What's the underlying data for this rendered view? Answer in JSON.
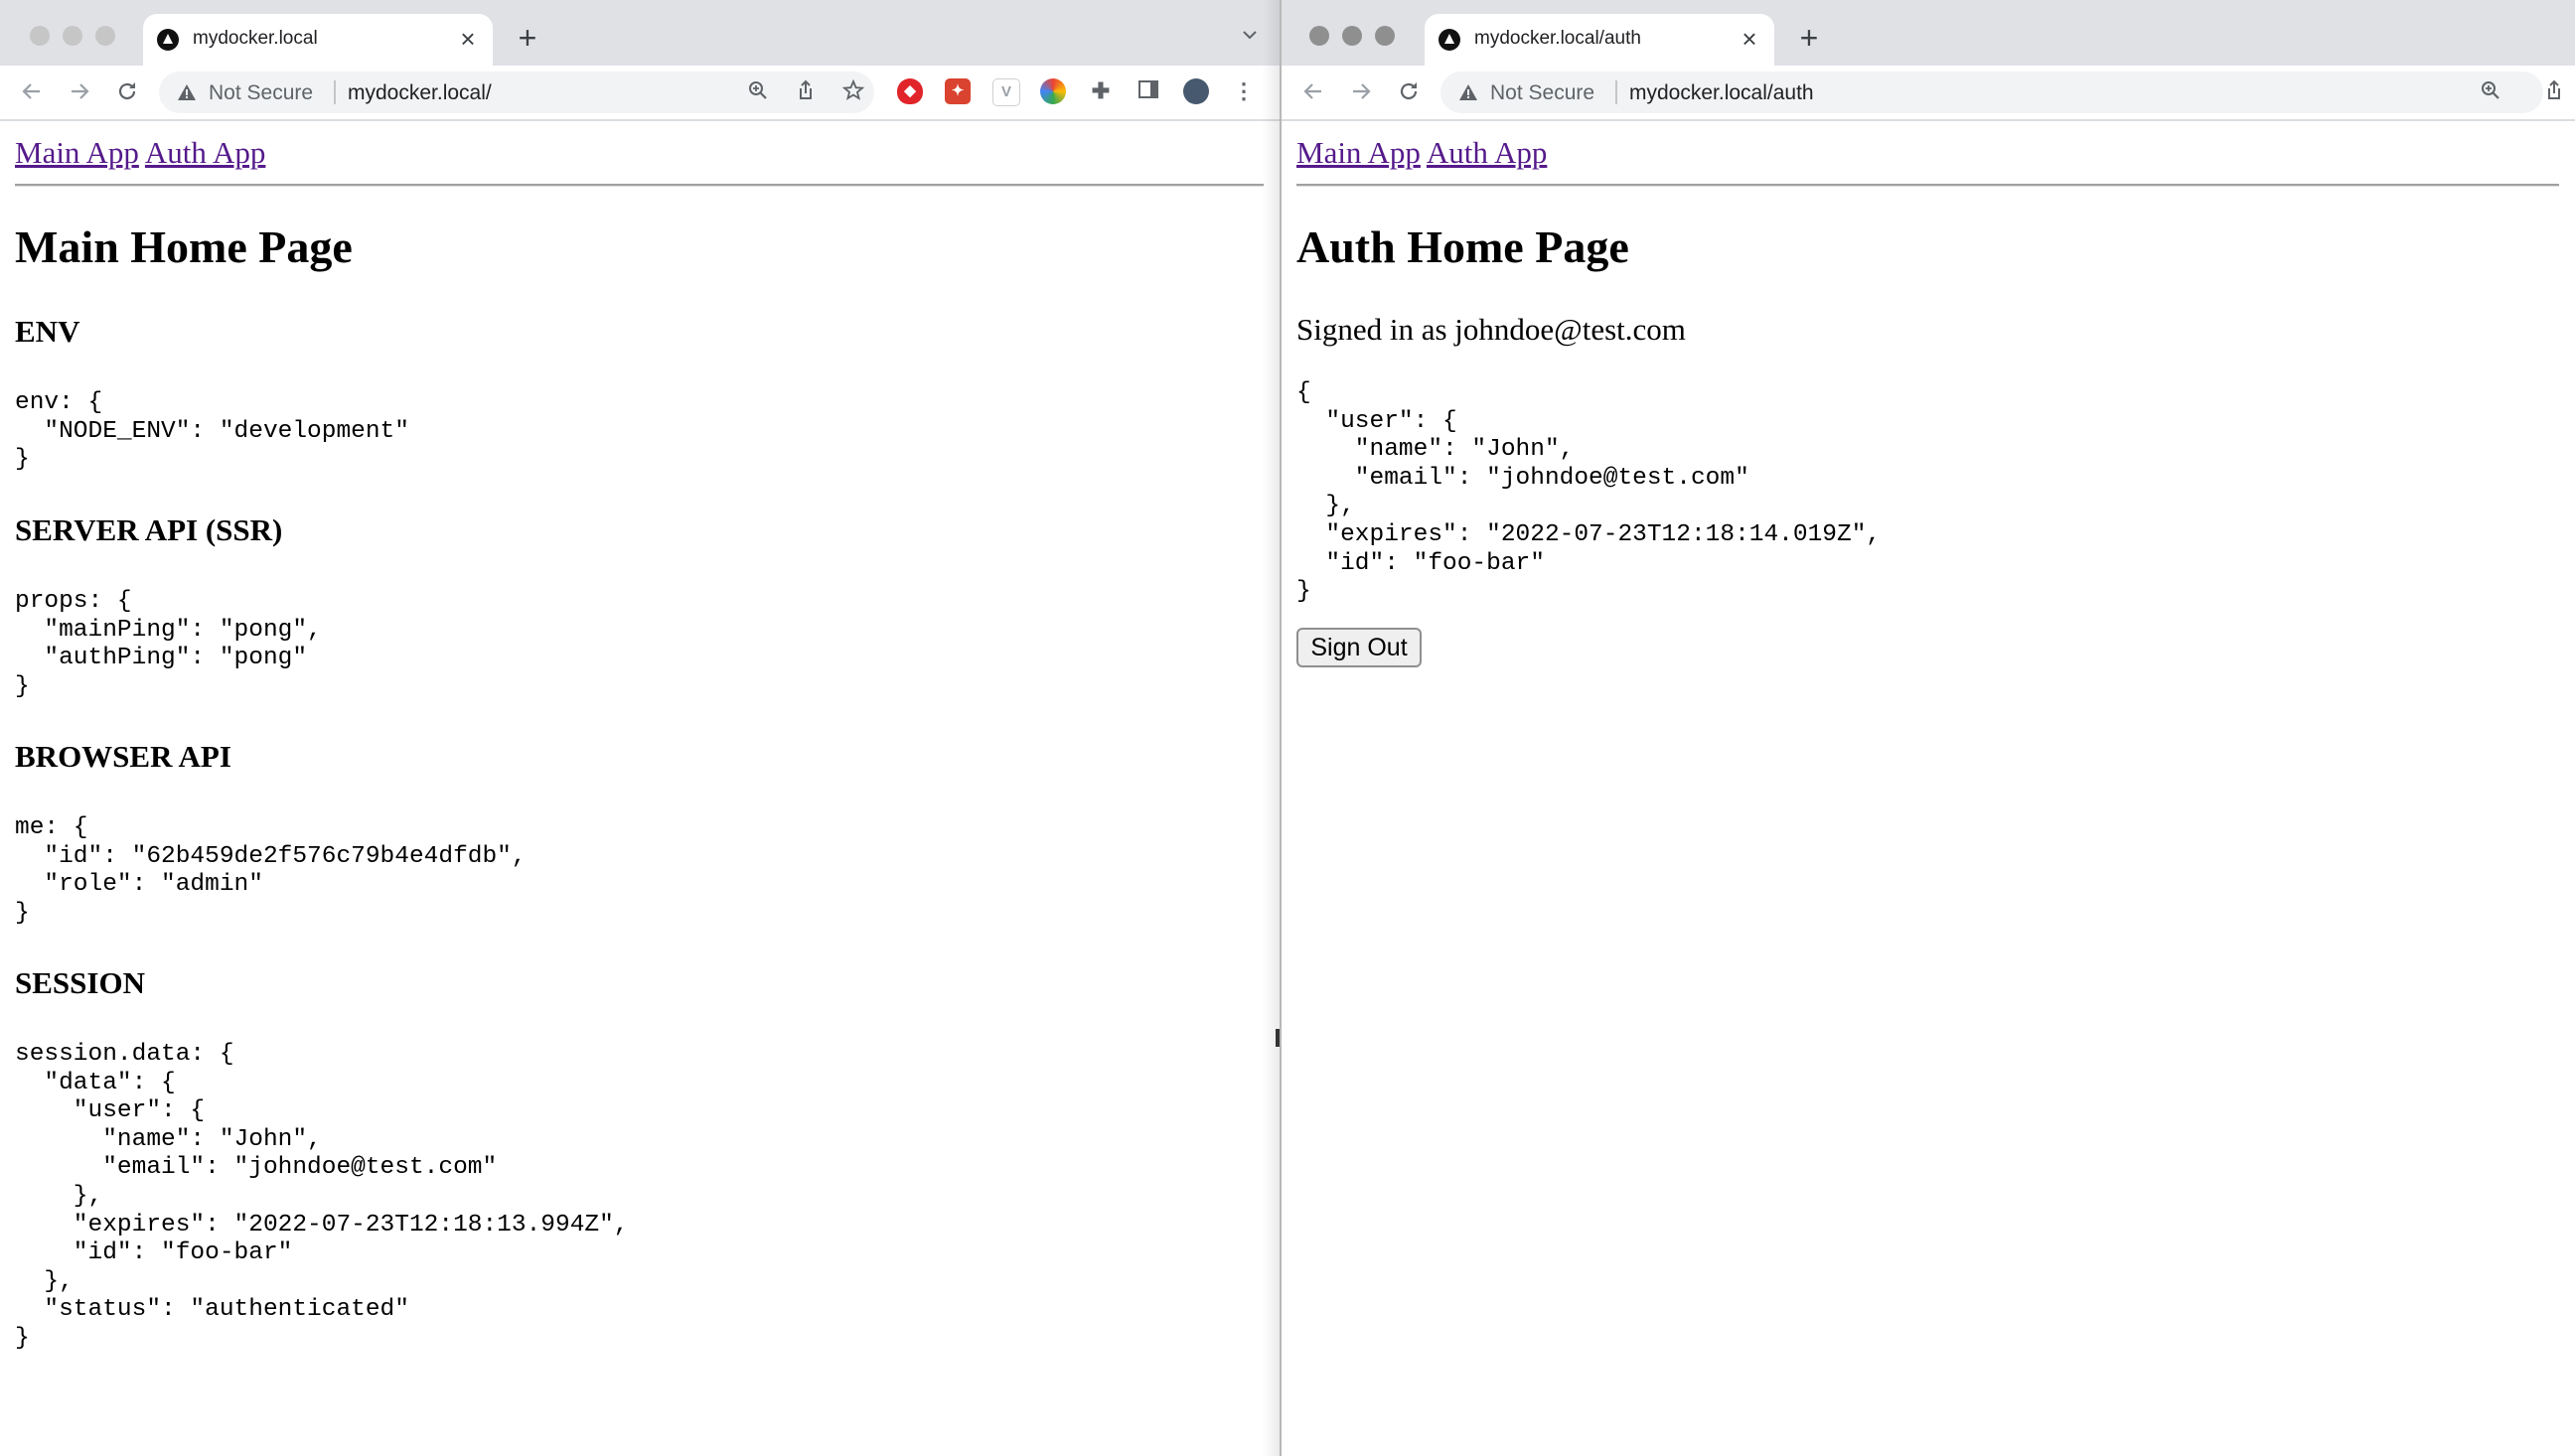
{
  "left_window": {
    "tab_title": "mydocker.local",
    "address": {
      "security_label": "Not Secure",
      "url": "mydocker.local/"
    },
    "nav_links": [
      "Main App",
      "Auth App"
    ],
    "heading": "Main Home Page",
    "sections": [
      {
        "title": "ENV",
        "code": "env: {\n  \"NODE_ENV\": \"development\"\n}"
      },
      {
        "title": "SERVER API (SSR)",
        "code": "props: {\n  \"mainPing\": \"pong\",\n  \"authPing\": \"pong\"\n}"
      },
      {
        "title": "BROWSER API",
        "code": "me: {\n  \"id\": \"62b459de2f576c79b4e4dfdb\",\n  \"role\": \"admin\"\n}"
      },
      {
        "title": "SESSION",
        "code": "session.data: {\n  \"data\": {\n    \"user\": {\n      \"name\": \"John\",\n      \"email\": \"johndoe@test.com\"\n    },\n    \"expires\": \"2022-07-23T12:18:13.994Z\",\n    \"id\": \"foo-bar\"\n  },\n  \"status\": \"authenticated\"\n}"
      }
    ],
    "icons": {
      "favicon": "triangle-favicon-icon",
      "back": "back-arrow-icon",
      "forward": "forward-arrow-icon",
      "reload": "reload-icon",
      "warning": "warning-icon",
      "zoom": "zoom-icon",
      "share": "share-icon",
      "bookmark": "star-icon",
      "extensions": "puzzle-icon",
      "side_panel": "side-panel-icon",
      "profile": "avatar",
      "menu": "kebab-menu-icon",
      "tab_dropdown": "chevron-down-icon"
    }
  },
  "right_window": {
    "tab_title": "mydocker.local/auth",
    "address": {
      "security_label": "Not Secure",
      "url": "mydocker.local/auth"
    },
    "nav_links": [
      "Main App",
      "Auth App"
    ],
    "heading": "Auth Home Page",
    "signed_in_text": "Signed in as johndoe@test.com",
    "code": "{\n  \"user\": {\n    \"name\": \"John\",\n    \"email\": \"johndoe@test.com\"\n  },\n  \"expires\": \"2022-07-23T12:18:14.019Z\",\n  \"id\": \"foo-bar\"\n}",
    "sign_out_label": "Sign Out"
  },
  "colors": {
    "link": "#551a8b",
    "tabstrip": "#dfe1e5",
    "omnibox": "#f1f3f4"
  }
}
